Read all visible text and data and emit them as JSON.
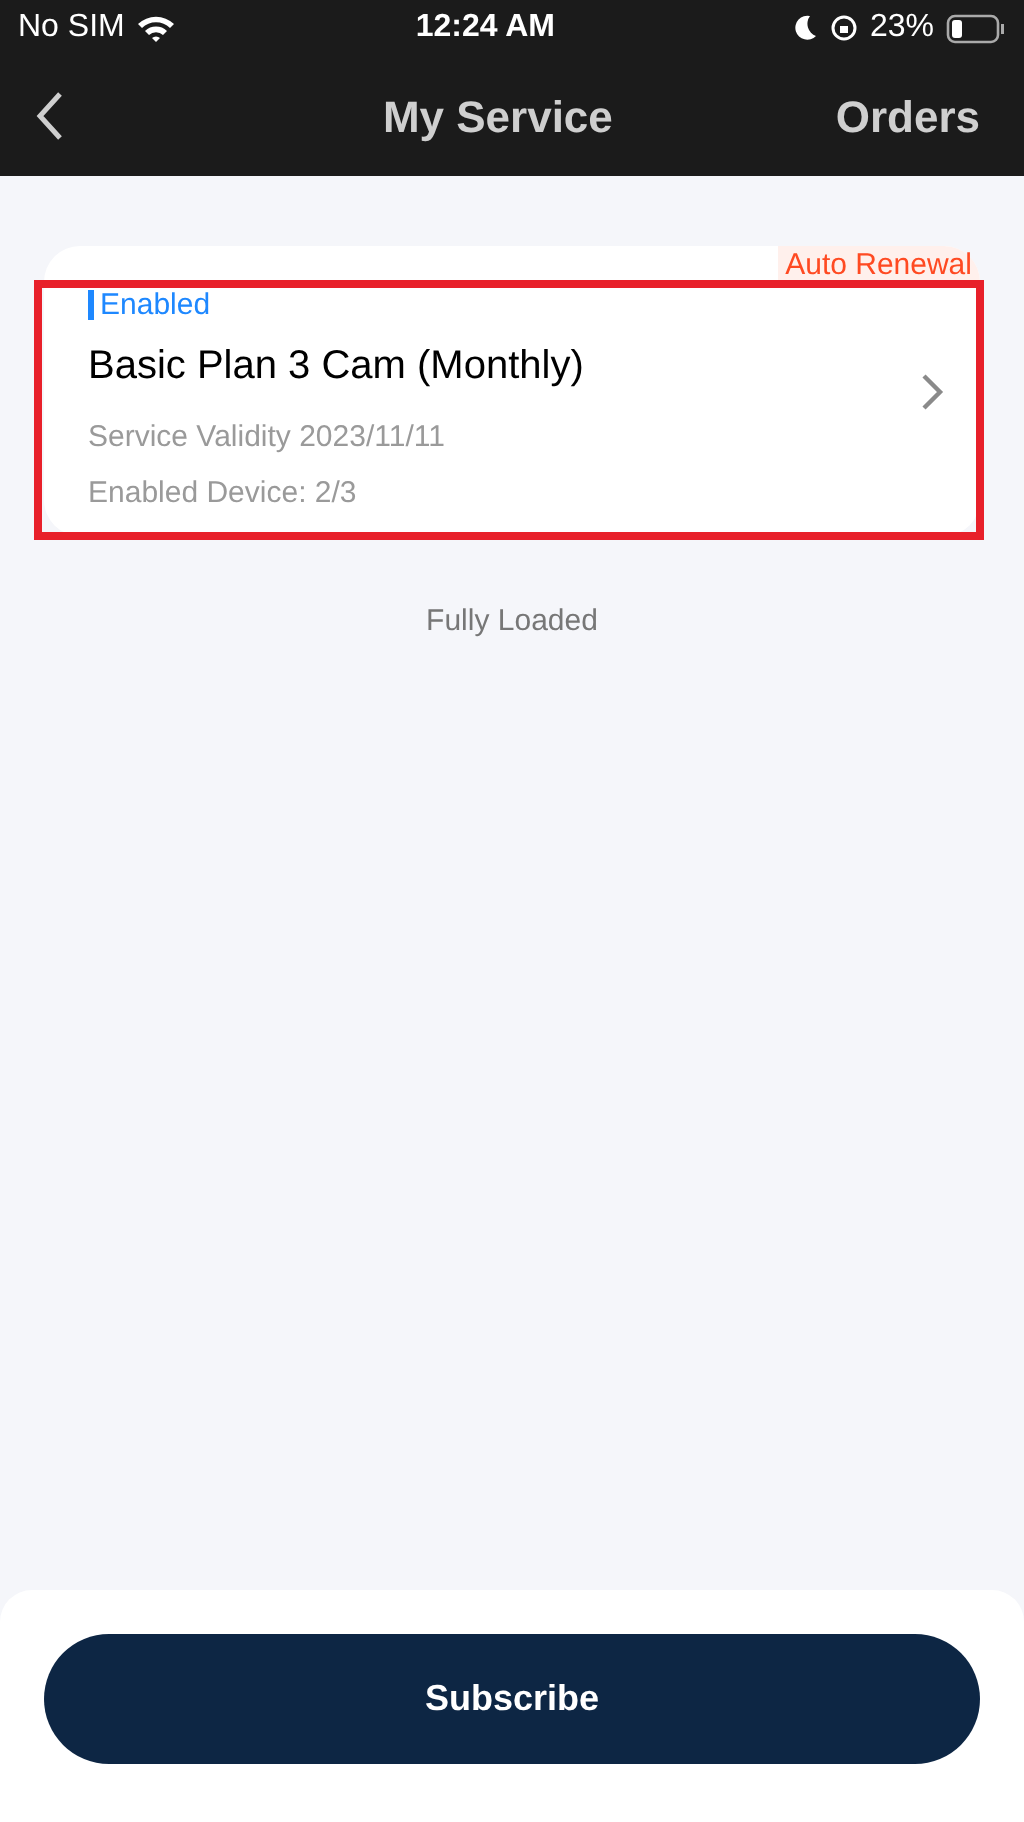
{
  "status_bar": {
    "carrier": "No SIM",
    "time": "12:24 AM",
    "battery": "23%"
  },
  "nav": {
    "title": "My Service",
    "action": "Orders"
  },
  "services": [
    {
      "status": "Enabled",
      "tag": "Auto Renewal",
      "name": "Basic Plan 3 Cam (Monthly)",
      "validity": "Service Validity 2023/11/11",
      "devices": "Enabled Device: 2/3",
      "highlighted": true
    }
  ],
  "footer_note": "Fully Loaded",
  "primary_button": "Subscribe"
}
